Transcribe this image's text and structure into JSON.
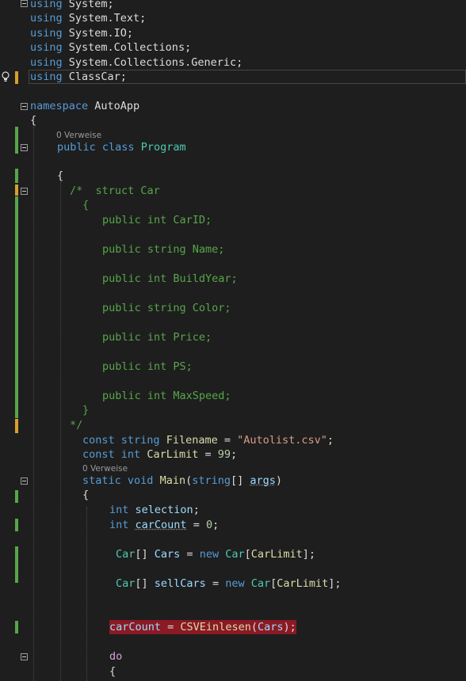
{
  "editor": {
    "codelens": [
      "0 Verweise",
      "0 Verweise"
    ],
    "lines": {
      "l1": [
        "using",
        " System;"
      ],
      "l2": [
        "using",
        " System.Text;"
      ],
      "l3": [
        "using",
        " System.IO;"
      ],
      "l4": [
        "using",
        " System.Collections;"
      ],
      "l5": [
        "using",
        " System.Collections.Generic;"
      ],
      "l6": [
        "using",
        " ClassCar;"
      ],
      "l7": [
        "namespace",
        " AutoApp"
      ],
      "l8": [
        "{"
      ],
      "l9": [
        "public",
        " ",
        "class",
        " ",
        "Program"
      ],
      "l10": [
        "{"
      ],
      "l11": [
        "/*  struct Car"
      ],
      "l12": [
        "{"
      ],
      "l13": [
        "public int CarID;"
      ],
      "l14": [
        "public string Name;"
      ],
      "l15": [
        "public int BuildYear;"
      ],
      "l16": [
        "public string Color;"
      ],
      "l17": [
        "public int Price;"
      ],
      "l18": [
        "public int PS;"
      ],
      "l19": [
        "public int MaxSpeed;"
      ],
      "l20": [
        "}"
      ],
      "l21": [
        "*/"
      ],
      "l22": [
        "const",
        " ",
        "string",
        " ",
        "Filename",
        " = ",
        "\"Autolist.csv\"",
        ";"
      ],
      "l23": [
        "const",
        " ",
        "int",
        " ",
        "CarLimit",
        " = ",
        "99",
        ";"
      ],
      "l24": [
        "static",
        " ",
        "void",
        " ",
        "Main",
        "(",
        "string",
        "[] ",
        "args",
        ")"
      ],
      "l25": [
        "{"
      ],
      "l26": [
        "int",
        " ",
        "selection",
        ";"
      ],
      "l27": [
        "int",
        " ",
        "carCount",
        " = ",
        "0",
        ";"
      ],
      "l28": [
        "Car",
        "[] ",
        "Cars",
        " = ",
        "new",
        " ",
        "Car",
        "[",
        "CarLimit",
        "];"
      ],
      "l29": [
        "Car",
        "[] ",
        "sellCars",
        " = ",
        "new",
        " ",
        "Car",
        "[",
        "CarLimit",
        "];"
      ],
      "l30": [
        "carCount",
        " = ",
        "CSVEinlesen",
        "(",
        "Cars",
        ");"
      ],
      "l31": [
        "do"
      ],
      "l32": [
        "{"
      ]
    },
    "colors": {
      "background": "#1e1e1e",
      "keyword": "#569cd6",
      "control_keyword": "#d8a0df",
      "type": "#4ec9b0",
      "variable": "#9cdcfe",
      "function": "#dcdcaa",
      "string": "#d69d85",
      "number": "#b5cea8",
      "comment": "#57a64a",
      "change_saved": "#57a64a",
      "change_unsaved": "#d6a02c",
      "breakpoint_highlight": "#8a1a24"
    },
    "icons": [
      "lightbulb-icon",
      "fold-collapse-icon"
    ]
  }
}
